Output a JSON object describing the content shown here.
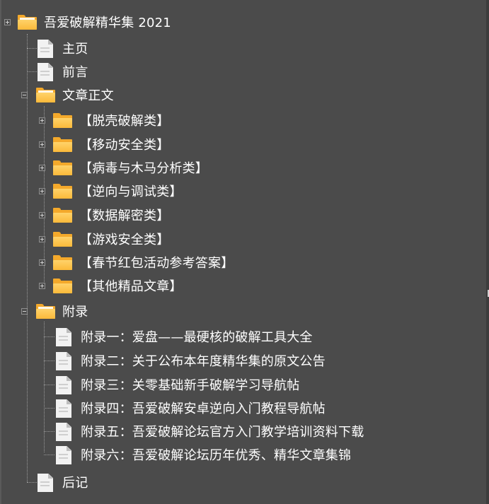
{
  "tree": {
    "root": {
      "label": "吾爱破解精华集 2021",
      "icon": "folder-open-icon",
      "children": [
        {
          "label": "主页",
          "icon": "document-icon"
        },
        {
          "label": "前言",
          "icon": "document-icon"
        },
        {
          "label": "文章正文",
          "icon": "folder-open-icon",
          "children": [
            {
              "label": "【脱壳破解类】",
              "icon": "folder-icon"
            },
            {
              "label": "【移动安全类】",
              "icon": "folder-icon"
            },
            {
              "label": "【病毒与木马分析类】",
              "icon": "folder-icon"
            },
            {
              "label": "【逆向与调试类】",
              "icon": "folder-icon"
            },
            {
              "label": "【数据解密类】",
              "icon": "folder-icon"
            },
            {
              "label": "【游戏安全类】",
              "icon": "folder-icon"
            },
            {
              "label": "【春节红包活动参考答案】",
              "icon": "folder-icon"
            },
            {
              "label": "【其他精品文章】",
              "icon": "folder-icon"
            }
          ]
        },
        {
          "label": "附录",
          "icon": "folder-open-icon",
          "children": [
            {
              "label": "附录一：爱盘——最硬核的破解工具大全",
              "icon": "document-icon"
            },
            {
              "label": "附录二：关于公布本年度精华集的原文公告",
              "icon": "document-icon"
            },
            {
              "label": "附录三：关零基础新手破解学习导航帖",
              "icon": "document-icon"
            },
            {
              "label": "附录四：吾爱破解安卓逆向入门教程导航帖",
              "icon": "document-icon"
            },
            {
              "label": "附录五：吾爱破解论坛官方入门教学培训资料下载",
              "icon": "document-icon"
            },
            {
              "label": "附录六：吾爱破解论坛历年优秀、精华文章集锦",
              "icon": "document-icon"
            }
          ]
        },
        {
          "label": "后记",
          "icon": "document-icon"
        }
      ]
    }
  },
  "colors": {
    "background": "#4b4b4b",
    "folder": "#f4a92b",
    "folder_light": "#ffd36a",
    "text": "#ffffff",
    "connector": "#9a9a9a"
  }
}
